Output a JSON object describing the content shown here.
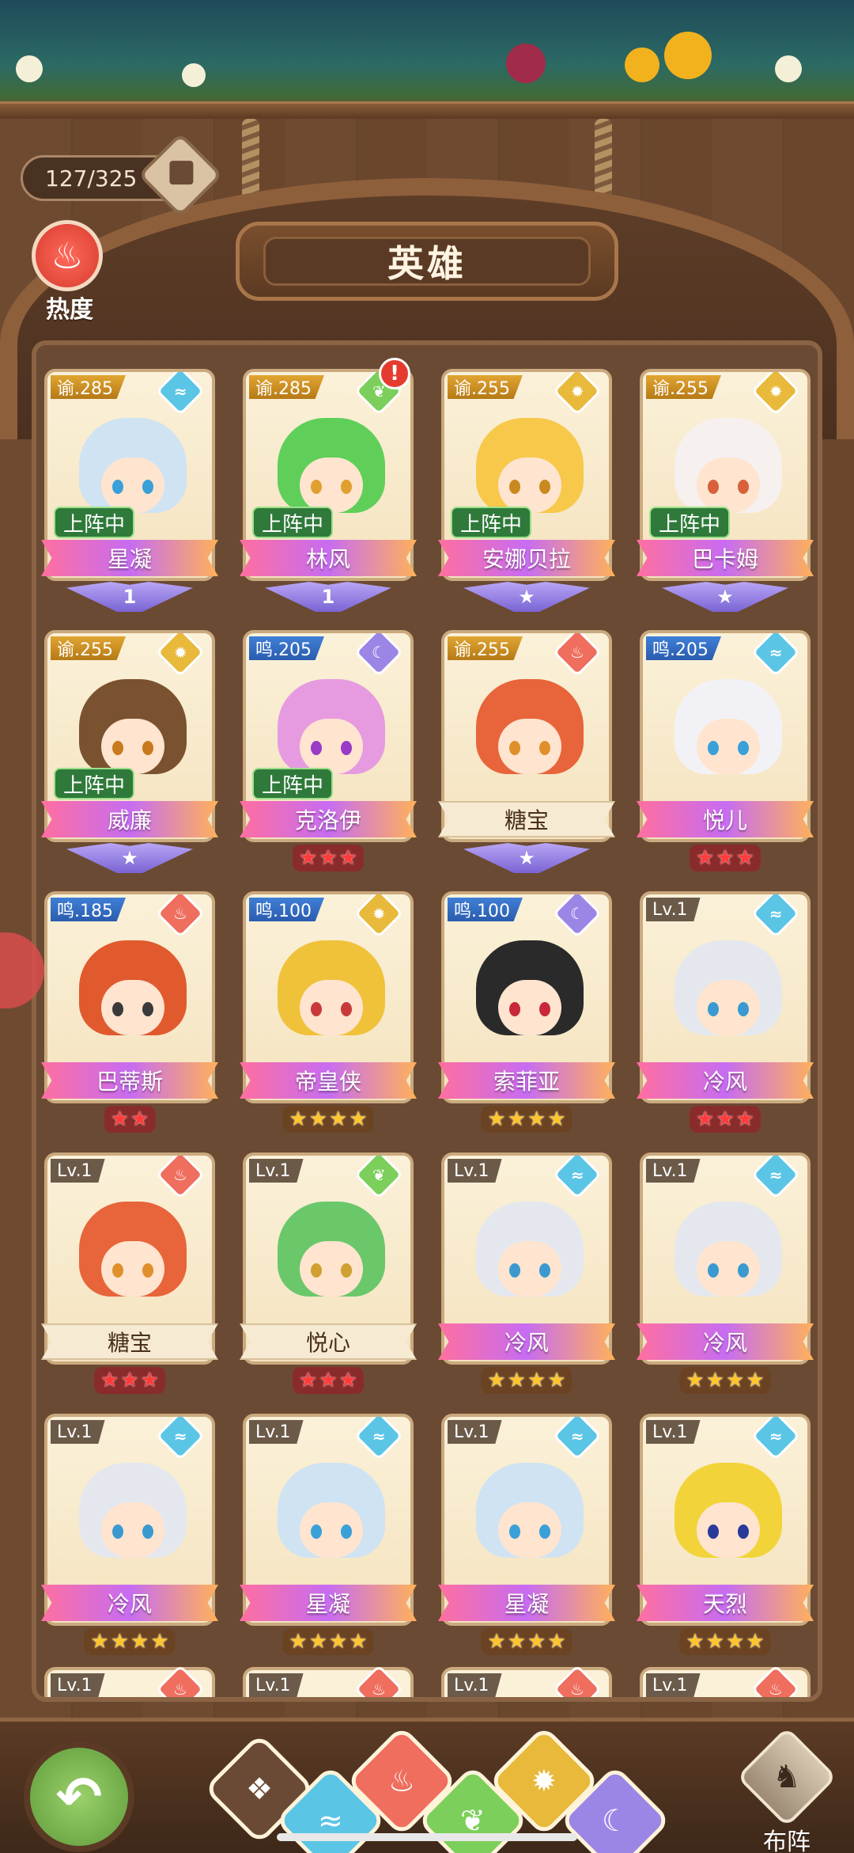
{
  "header": {
    "counter": "127/325",
    "title": "英雄",
    "heat_label": "热度",
    "heat_icon": "flame-icon"
  },
  "heroes": [
    {
      "name": "星凝",
      "level": "谕.285",
      "level_style": "gold",
      "element": "water",
      "deployed": "上阵中",
      "rank_type": "wings",
      "rank": "1",
      "alert": false,
      "hair": "#cfe3f3",
      "eye": "#3aa0d8"
    },
    {
      "name": "林风",
      "level": "谕.285",
      "level_style": "gold",
      "element": "wood",
      "deployed": "上阵中",
      "rank_type": "wings",
      "rank": "1",
      "alert": true,
      "hair": "#5fcf5a",
      "eye": "#e0a030"
    },
    {
      "name": "安娜贝拉",
      "level": "谕.255",
      "level_style": "gold",
      "element": "light",
      "deployed": "上阵中",
      "rank_type": "wings",
      "rank": "★",
      "alert": false,
      "hair": "#f7c84a",
      "eye": "#c88a1e"
    },
    {
      "name": "巴卡姆",
      "level": "谕.255",
      "level_style": "gold",
      "element": "light",
      "deployed": "上阵中",
      "rank_type": "wings",
      "rank": "★",
      "alert": false,
      "hair": "#f6f0ef",
      "eye": "#d8603a"
    },
    {
      "name": "威廉",
      "level": "谕.255",
      "level_style": "gold",
      "element": "light",
      "deployed": "上阵中",
      "rank_type": "wings",
      "rank": "★",
      "alert": false,
      "hair": "#7a5230",
      "eye": "#c87a1e"
    },
    {
      "name": "克洛伊",
      "level": "鸣.205",
      "level_style": "blue",
      "element": "dark",
      "deployed": "上阵中",
      "rank_type": "stars",
      "stars": 3,
      "star_color": "red",
      "alert": false,
      "hair": "#e69be0",
      "eye": "#9a3ac8"
    },
    {
      "name": "糖宝",
      "level": "谕.255",
      "level_style": "gold",
      "element": "fire",
      "deployed": "",
      "rank_type": "wings",
      "rank": "★",
      "ribbon": "cream",
      "alert": false,
      "hair": "#e8643a",
      "eye": "#e0902a"
    },
    {
      "name": "悦儿",
      "level": "鸣.205",
      "level_style": "blue",
      "element": "water",
      "deployed": "",
      "rank_type": "stars",
      "stars": 3,
      "star_color": "red",
      "alert": false,
      "hair": "#f2f2f6",
      "eye": "#3aa0d8"
    },
    {
      "name": "巴蒂斯",
      "level": "鸣.185",
      "level_style": "blue",
      "element": "fire",
      "deployed": "",
      "rank_type": "stars",
      "stars": 2,
      "star_color": "red",
      "alert": false,
      "hair": "#e05a2e",
      "eye": "#3a3a3a"
    },
    {
      "name": "帝皇侠",
      "level": "鸣.100",
      "level_style": "blue",
      "element": "light",
      "deployed": "",
      "rank_type": "stars",
      "stars": 4,
      "star_color": "gold",
      "alert": false,
      "hair": "#f0c23a",
      "eye": "#c83a3a"
    },
    {
      "name": "索菲亚",
      "level": "鸣.100",
      "level_style": "blue",
      "element": "dark",
      "deployed": "",
      "rank_type": "stars",
      "stars": 4,
      "star_color": "gold",
      "alert": false,
      "hair": "#2a2a2a",
      "eye": "#c8283a"
    },
    {
      "name": "冷风",
      "level": "Lv.1",
      "level_style": "plain",
      "element": "water",
      "deployed": "",
      "rank_type": "stars",
      "stars": 3,
      "star_color": "red",
      "alert": false,
      "hair": "#e4e8ee",
      "eye": "#3a9ad0"
    },
    {
      "name": "糖宝",
      "level": "Lv.1",
      "level_style": "plain",
      "element": "fire",
      "deployed": "",
      "rank_type": "stars",
      "stars": 3,
      "star_color": "red",
      "ribbon": "cream",
      "alert": false,
      "hair": "#e8643a",
      "eye": "#e0902a"
    },
    {
      "name": "悦心",
      "level": "Lv.1",
      "level_style": "plain",
      "element": "wood",
      "deployed": "",
      "rank_type": "stars",
      "stars": 3,
      "star_color": "red",
      "ribbon": "cream",
      "alert": false,
      "hair": "#6ac86a",
      "eye": "#d0a030"
    },
    {
      "name": "冷风",
      "level": "Lv.1",
      "level_style": "plain",
      "element": "water",
      "deployed": "",
      "rank_type": "stars",
      "stars": 4,
      "star_color": "gold",
      "alert": false,
      "hair": "#e4e8ee",
      "eye": "#3a9ad0"
    },
    {
      "name": "冷风",
      "level": "Lv.1",
      "level_style": "plain",
      "element": "water",
      "deployed": "",
      "rank_type": "stars",
      "stars": 4,
      "star_color": "gold",
      "alert": false,
      "hair": "#e4e8ee",
      "eye": "#3a9ad0"
    },
    {
      "name": "冷风",
      "level": "Lv.1",
      "level_style": "plain",
      "element": "water",
      "deployed": "",
      "rank_type": "stars",
      "stars": 4,
      "star_color": "gold",
      "alert": false,
      "hair": "#e4e8ee",
      "eye": "#3a9ad0"
    },
    {
      "name": "星凝",
      "level": "Lv.1",
      "level_style": "plain",
      "element": "water",
      "deployed": "",
      "rank_type": "stars",
      "stars": 4,
      "star_color": "gold",
      "alert": false,
      "hair": "#cfe3f3",
      "eye": "#3aa0d8"
    },
    {
      "name": "星凝",
      "level": "Lv.1",
      "level_style": "plain",
      "element": "water",
      "deployed": "",
      "rank_type": "stars",
      "stars": 4,
      "star_color": "gold",
      "alert": false,
      "hair": "#cfe3f3",
      "eye": "#3aa0d8"
    },
    {
      "name": "天烈",
      "level": "Lv.1",
      "level_style": "plain",
      "element": "water",
      "deployed": "",
      "rank_type": "stars",
      "stars": 4,
      "star_color": "gold",
      "alert": false,
      "hair": "#f2d43a",
      "eye": "#2a3a9a"
    }
  ],
  "partial_row": [
    {
      "level": "Lv.1",
      "element": "fire"
    },
    {
      "level": "Lv.1",
      "element": "fire"
    },
    {
      "level": "Lv.1",
      "element": "fire"
    },
    {
      "level": "Lv.1",
      "element": "fire"
    }
  ],
  "elements": {
    "water": {
      "color": "#5bc5e6",
      "glyph": "≈",
      "icon": "water-icon"
    },
    "wood": {
      "color": "#7ccf5a",
      "glyph": "❦",
      "icon": "leaf-icon"
    },
    "light": {
      "color": "#e8b93a",
      "glyph": "✹",
      "icon": "sun-icon"
    },
    "dark": {
      "color": "#9b86e6",
      "glyph": "☾",
      "icon": "moon-icon"
    },
    "fire": {
      "color": "#ef6e5e",
      "glyph": "♨",
      "icon": "flame-icon"
    }
  },
  "bottom_nav": {
    "back_icon": "back-arrow-icon",
    "filters": [
      {
        "id": "all",
        "color": "#6b4a35",
        "glyph": "❖",
        "icon": "all-elements-icon"
      },
      {
        "id": "water",
        "color": "#5bc5e6",
        "glyph": "≈",
        "icon": "water-icon"
      },
      {
        "id": "fire",
        "color": "#ef6e5e",
        "glyph": "♨",
        "icon": "flame-icon"
      },
      {
        "id": "wood",
        "color": "#7ccf5a",
        "glyph": "❦",
        "icon": "leaf-icon"
      },
      {
        "id": "light",
        "color": "#e8b93a",
        "glyph": "✹",
        "icon": "sun-icon"
      },
      {
        "id": "dark",
        "color": "#9b86e6",
        "glyph": "☾",
        "icon": "moon-icon"
      }
    ],
    "formation_label": "布阵",
    "formation_icon": "chess-icon"
  }
}
